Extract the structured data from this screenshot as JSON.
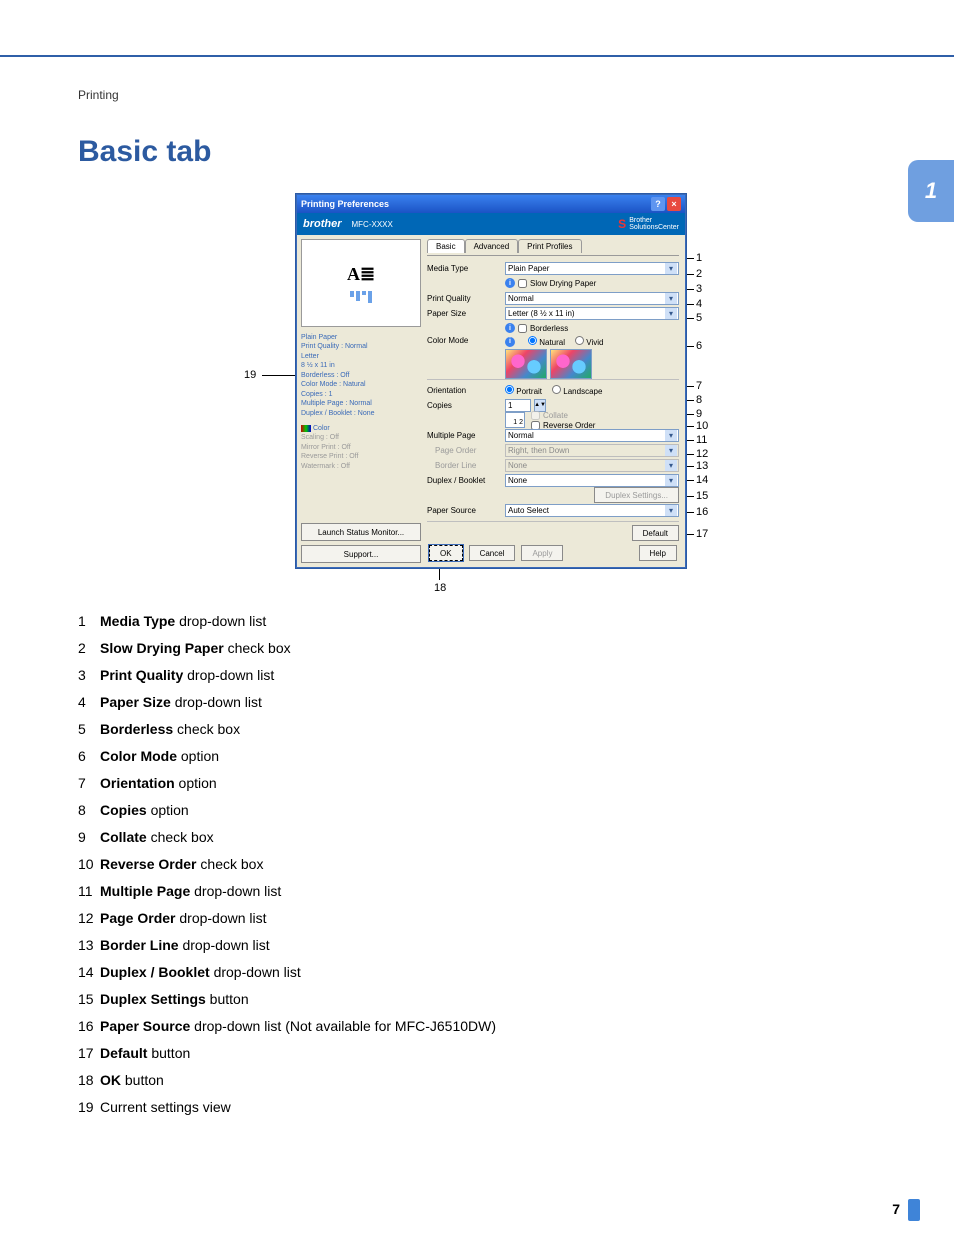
{
  "header": {
    "section": "Printing"
  },
  "title": "Basic tab",
  "chapterTab": "1",
  "pageNumber": "7",
  "dialog": {
    "title": "Printing Preferences",
    "brand": "brother",
    "model": "MFC-XXXX",
    "solutions": "Brother\nSolutionsCenter",
    "tabs": {
      "basic": "Basic",
      "advanced": "Advanced",
      "profiles": "Print Profiles"
    },
    "left": {
      "settings": [
        "Plain Paper",
        "Print Quality : Normal",
        "Letter",
        "8 ½ x 11 in",
        "Borderless : Off",
        "Color Mode : Natural",
        "Copies : 1",
        "Multiple Page : Normal",
        "Duplex / Booklet : None"
      ],
      "colorLabel": "Color",
      "extra": [
        "Scaling : Off",
        "Mirror Print : Off",
        "Reverse Print : Off",
        "Watermark : Off"
      ],
      "launch": "Launch Status Monitor...",
      "support": "Support..."
    },
    "right": {
      "mediaType": {
        "label": "Media Type",
        "value": "Plain Paper"
      },
      "slowDry": {
        "label": "Slow Drying Paper"
      },
      "printQuality": {
        "label": "Print Quality",
        "value": "Normal"
      },
      "paperSize": {
        "label": "Paper Size",
        "value": "Letter (8 ½ x 11 in)"
      },
      "borderless": {
        "label": "Borderless"
      },
      "colorMode": {
        "label": "Color Mode",
        "natural": "Natural",
        "vivid": "Vivid"
      },
      "orientation": {
        "label": "Orientation",
        "portrait": "Portrait",
        "landscape": "Landscape"
      },
      "copies": {
        "label": "Copies",
        "value": "1",
        "collate": "Collate",
        "reverse": "Reverse Order"
      },
      "multiplePage": {
        "label": "Multiple Page",
        "value": "Normal"
      },
      "pageOrder": {
        "label": "Page Order",
        "value": "Right, then Down"
      },
      "borderLine": {
        "label": "Border Line",
        "value": "None"
      },
      "duplex": {
        "label": "Duplex / Booklet",
        "value": "None"
      },
      "duplexSettings": "Duplex Settings...",
      "paperSource": {
        "label": "Paper Source",
        "value": "Auto Select"
      },
      "default": "Default"
    },
    "footer": {
      "ok": "OK",
      "cancel": "Cancel",
      "apply": "Apply",
      "help": "Help"
    }
  },
  "callouts": {
    "left19": "19",
    "r": [
      "1",
      "2",
      "3",
      "4",
      "5",
      "6",
      "7",
      "8",
      "9",
      "10",
      "11",
      "12",
      "13",
      "14",
      "15",
      "16",
      "17"
    ],
    "bottom18": "18"
  },
  "list": [
    {
      "n": "1",
      "b": "Media Type",
      "t": " drop-down list"
    },
    {
      "n": "2",
      "b": "Slow Drying Paper",
      "t": " check box"
    },
    {
      "n": "3",
      "b": "Print Quality",
      "t": " drop-down list"
    },
    {
      "n": "4",
      "b": "Paper Size",
      "t": " drop-down list"
    },
    {
      "n": "5",
      "b": "Borderless",
      "t": " check box"
    },
    {
      "n": "6",
      "b": "Color Mode",
      "t": " option"
    },
    {
      "n": "7",
      "b": "Orientation",
      "t": " option"
    },
    {
      "n": "8",
      "b": "Copies",
      "t": " option"
    },
    {
      "n": "9",
      "b": "Collate",
      "t": " check box"
    },
    {
      "n": "10",
      "b": "Reverse Order",
      "t": " check box"
    },
    {
      "n": "11",
      "b": "Multiple Page",
      "t": " drop-down list"
    },
    {
      "n": "12",
      "b": "Page Order",
      "t": " drop-down list"
    },
    {
      "n": "13",
      "b": "Border Line",
      "t": " drop-down list"
    },
    {
      "n": "14",
      "b": "Duplex / Booklet",
      "t": " drop-down list"
    },
    {
      "n": "15",
      "b": "Duplex Settings",
      "t": " button"
    },
    {
      "n": "16",
      "b": "Paper Source",
      "t": " drop-down list (Not available for MFC-J6510DW)"
    },
    {
      "n": "17",
      "b": "Default",
      "t": " button"
    },
    {
      "n": "18",
      "b": "OK",
      "t": " button"
    },
    {
      "n": "19",
      "b": "",
      "t": "Current settings view"
    }
  ]
}
